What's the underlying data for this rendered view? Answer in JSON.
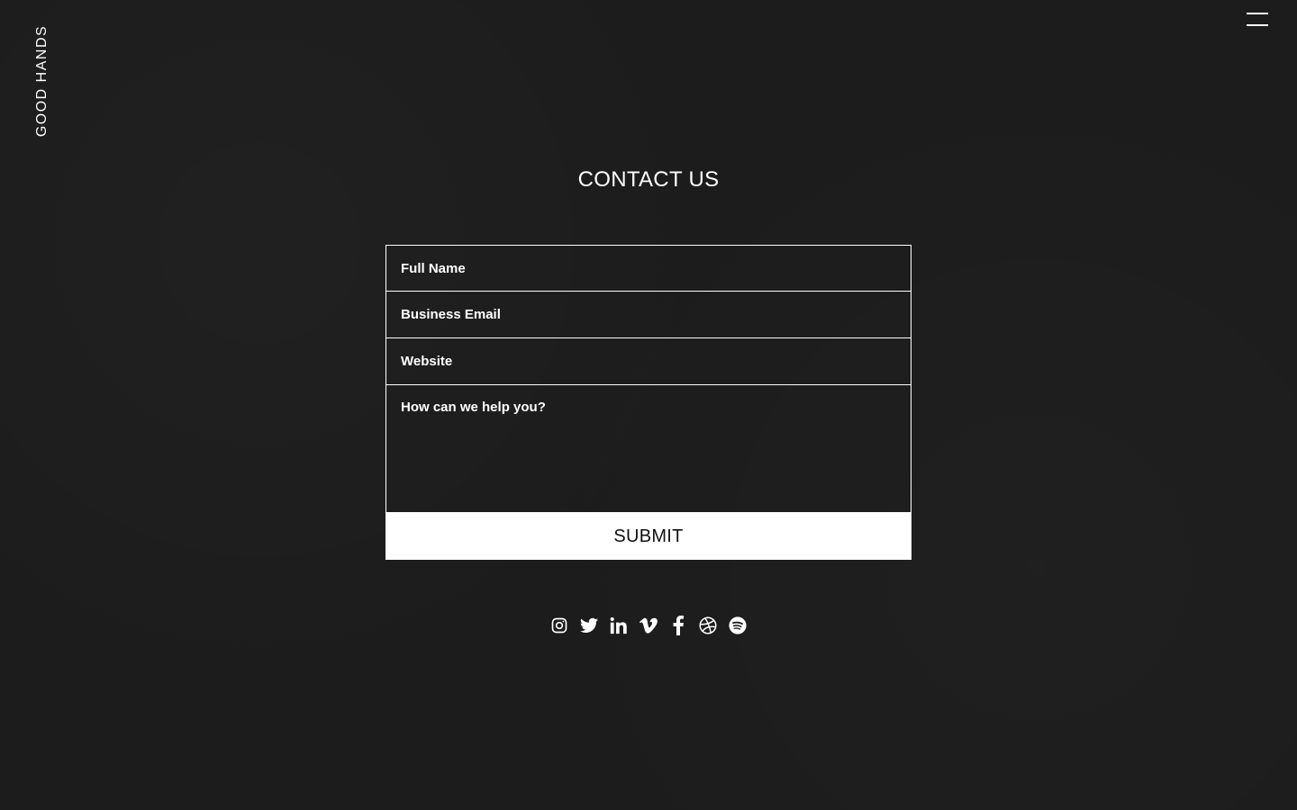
{
  "brand": {
    "name": "GOOD HANDS"
  },
  "header": {
    "menu_icon": "hamburger-icon"
  },
  "page": {
    "title": "CONTACT US"
  },
  "form": {
    "full_name": {
      "placeholder": "Full Name",
      "value": ""
    },
    "business_email": {
      "placeholder": "Business Email",
      "value": ""
    },
    "website": {
      "placeholder": "Website",
      "value": ""
    },
    "message": {
      "placeholder": "How can we help you?",
      "value": ""
    },
    "submit_label": "SUBMIT"
  },
  "social": {
    "icons": [
      "instagram-icon",
      "twitter-icon",
      "linkedin-icon",
      "vimeo-icon",
      "facebook-icon",
      "dribbble-icon",
      "spotify-icon"
    ]
  },
  "colors": {
    "background": "#1c1c1c",
    "foreground": "#ffffff",
    "button_text": "#111111"
  }
}
